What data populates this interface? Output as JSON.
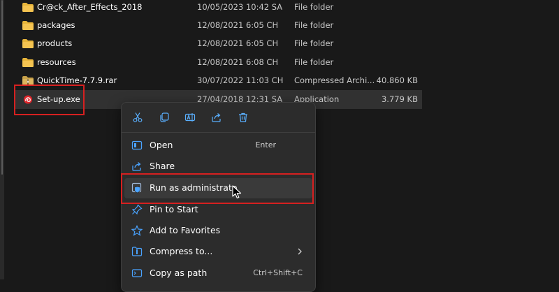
{
  "files": [
    {
      "name": "Cr@ck_After_Effects_2018",
      "date": "10/05/2023 10:42 SA",
      "type": "File folder",
      "size": "",
      "icon": "folder-icon"
    },
    {
      "name": "packages",
      "date": "12/08/2021 6:05 CH",
      "type": "File folder",
      "size": "",
      "icon": "folder-icon"
    },
    {
      "name": "products",
      "date": "12/08/2021 6:05 CH",
      "type": "File folder",
      "size": "",
      "icon": "folder-icon"
    },
    {
      "name": "resources",
      "date": "12/08/2021 6:08 CH",
      "type": "File folder",
      "size": "",
      "icon": "folder-icon"
    },
    {
      "name": "QuickTime-7.7.9.rar",
      "date": "30/07/2022 11:03 CH",
      "type": "Compressed Archi...",
      "size": "40.860 KB",
      "icon": "archive-icon"
    },
    {
      "name": "Set-up.exe",
      "date": "27/04/2018 12:31 SA",
      "type": "Application",
      "size": "3.779 KB",
      "icon": "adobe-app-icon"
    }
  ],
  "context_menu": {
    "quick_actions": [
      "cut-icon",
      "copy-icon",
      "rename-icon",
      "share-icon",
      "delete-icon"
    ],
    "items": [
      {
        "label": "Open",
        "shortcut": "Enter",
        "icon": "open-icon"
      },
      {
        "label": "Share",
        "shortcut": "",
        "icon": "share-icon"
      },
      {
        "label": "Run as administrato",
        "shortcut": "",
        "icon": "shield-icon"
      },
      {
        "label": "Pin to Start",
        "shortcut": "",
        "icon": "pin-icon"
      },
      {
        "label": "Add to Favorites",
        "shortcut": "",
        "icon": "star-icon"
      },
      {
        "label": "Compress to...",
        "shortcut": "",
        "icon": "compress-icon",
        "submenu": true
      },
      {
        "label": "Copy as path",
        "shortcut": "Ctrl+Shift+C",
        "icon": "copy-path-icon"
      }
    ]
  },
  "colors": {
    "highlight_border": "#d62020",
    "accent": "#4aa3ff",
    "folder": "#e8b53a"
  }
}
